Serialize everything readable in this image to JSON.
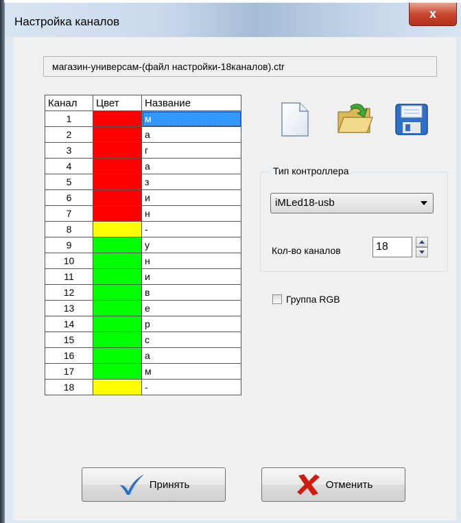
{
  "window": {
    "title": "Настройка каналов",
    "close_label": "x"
  },
  "file_name": "магазин-универсам-(файл настройки-18каналов).ctr",
  "table": {
    "headers": [
      "Канал",
      "Цвет",
      "Название"
    ],
    "selected_row": 0,
    "rows": [
      {
        "channel": "1",
        "color": "#ff0000",
        "name": "м"
      },
      {
        "channel": "2",
        "color": "#ff0000",
        "name": "а"
      },
      {
        "channel": "3",
        "color": "#ff0000",
        "name": "г"
      },
      {
        "channel": "4",
        "color": "#ff0000",
        "name": "а"
      },
      {
        "channel": "5",
        "color": "#ff0000",
        "name": "з"
      },
      {
        "channel": "6",
        "color": "#ff0000",
        "name": "и"
      },
      {
        "channel": "7",
        "color": "#ff0000",
        "name": "н"
      },
      {
        "channel": "8",
        "color": "#ffff00",
        "name": "-"
      },
      {
        "channel": "9",
        "color": "#00ff00",
        "name": "у"
      },
      {
        "channel": "10",
        "color": "#00ff00",
        "name": "н"
      },
      {
        "channel": "11",
        "color": "#00ff00",
        "name": "и"
      },
      {
        "channel": "12",
        "color": "#00ff00",
        "name": "в"
      },
      {
        "channel": "13",
        "color": "#00ff00",
        "name": "е"
      },
      {
        "channel": "14",
        "color": "#00ff00",
        "name": "р"
      },
      {
        "channel": "15",
        "color": "#00ff00",
        "name": "с"
      },
      {
        "channel": "16",
        "color": "#00ff00",
        "name": "а"
      },
      {
        "channel": "17",
        "color": "#00ff00",
        "name": "м"
      },
      {
        "channel": "18",
        "color": "#ffff00",
        "name": "-"
      }
    ]
  },
  "toolbar": {
    "icons": [
      "new-file-icon",
      "open-folder-icon",
      "save-disk-icon"
    ]
  },
  "controller": {
    "group_label": "Тип контроллера",
    "selected_type": "iMLed18-usb",
    "channel_count_label": "Кол-во каналов",
    "channel_count": "18"
  },
  "rgb_group": {
    "label": "Группа RGB",
    "checked": false
  },
  "buttons": {
    "accept": "Принять",
    "cancel": "Отменить"
  },
  "colors": {
    "selection": "#3399ff",
    "accept_check": "#2c6fc9",
    "cancel_cross": "#d11b10"
  }
}
